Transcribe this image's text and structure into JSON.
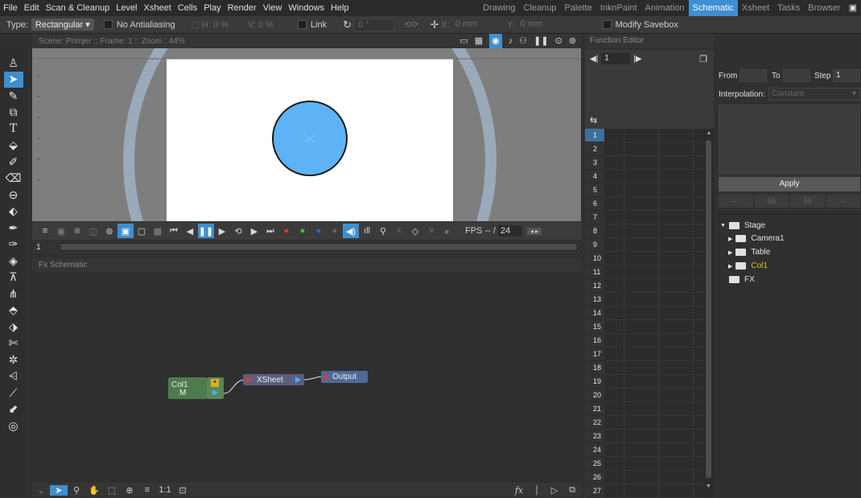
{
  "menu": [
    "File",
    "Edit",
    "Scan & Cleanup",
    "Level",
    "Xsheet",
    "Cells",
    "Play",
    "Render",
    "View",
    "Windows",
    "Help"
  ],
  "rooms": [
    {
      "label": "Drawing",
      "active": false
    },
    {
      "label": "Cleanup",
      "active": false
    },
    {
      "label": "Palette",
      "active": false
    },
    {
      "label": "InknPaint",
      "active": false
    },
    {
      "label": "Animation",
      "active": false
    },
    {
      "label": "Schematic",
      "active": true
    },
    {
      "label": "Xsheet",
      "active": false
    },
    {
      "label": "Tasks",
      "active": false
    },
    {
      "label": "Browser",
      "active": false
    }
  ],
  "options": {
    "type_label": "Type:",
    "type_value": "Rectangular",
    "no_antialiasing": "No Antialiasing",
    "h_label": "H:",
    "h_value": "0 %",
    "v_label": "V:",
    "v_value": "0 %",
    "link_label": "Link",
    "rot_value": "0 °",
    "x_label": "X:",
    "x_value": "0 mm",
    "y_label": "Y:",
    "y_value": "0 mm",
    "modify_savebox": "Modify Savebox"
  },
  "viewer": {
    "title": "Scene: Primjer  ::  Frame: 1  ::  Zoom : 44%",
    "fps_label": "FPS -- /",
    "fps_value": "24",
    "frame_value": "1"
  },
  "schematic": {
    "title": "Fx Schematic",
    "nodes": {
      "col_name": "Col1",
      "col_sub": "M",
      "xsheet": "XSheet",
      "output": "Output"
    },
    "zoom_label": "1:1",
    "fx_label": "fx"
  },
  "function_editor": {
    "title": "Function Editor",
    "frame_field": "1",
    "rows": [
      "1",
      "2",
      "3",
      "4",
      "5",
      "6",
      "7",
      "8",
      "9",
      "10",
      "11",
      "12",
      "13",
      "14",
      "15",
      "16",
      "17",
      "18",
      "19",
      "20",
      "21",
      "22",
      "23",
      "24",
      "25",
      "26",
      "27"
    ]
  },
  "spreadsheet_panel": {
    "from_label": "From",
    "to_label": "To",
    "step_label": "Step",
    "step_value": "1",
    "interpolation_label": "Interpolation:",
    "interpolation_value": "Constant",
    "apply_label": "Apply"
  },
  "tree": {
    "stage": "Stage",
    "camera": "Camera1",
    "table": "Table",
    "col": "Col1",
    "fx": "FX"
  },
  "colors": {
    "accent": "#3d8fd2",
    "circle_fill": "#5db3f5",
    "col_node": "#4e7a4e",
    "xsheet_node": "#5c5e7e",
    "output_node": "#4e6a96",
    "col_highlight": "#d9c31e"
  }
}
